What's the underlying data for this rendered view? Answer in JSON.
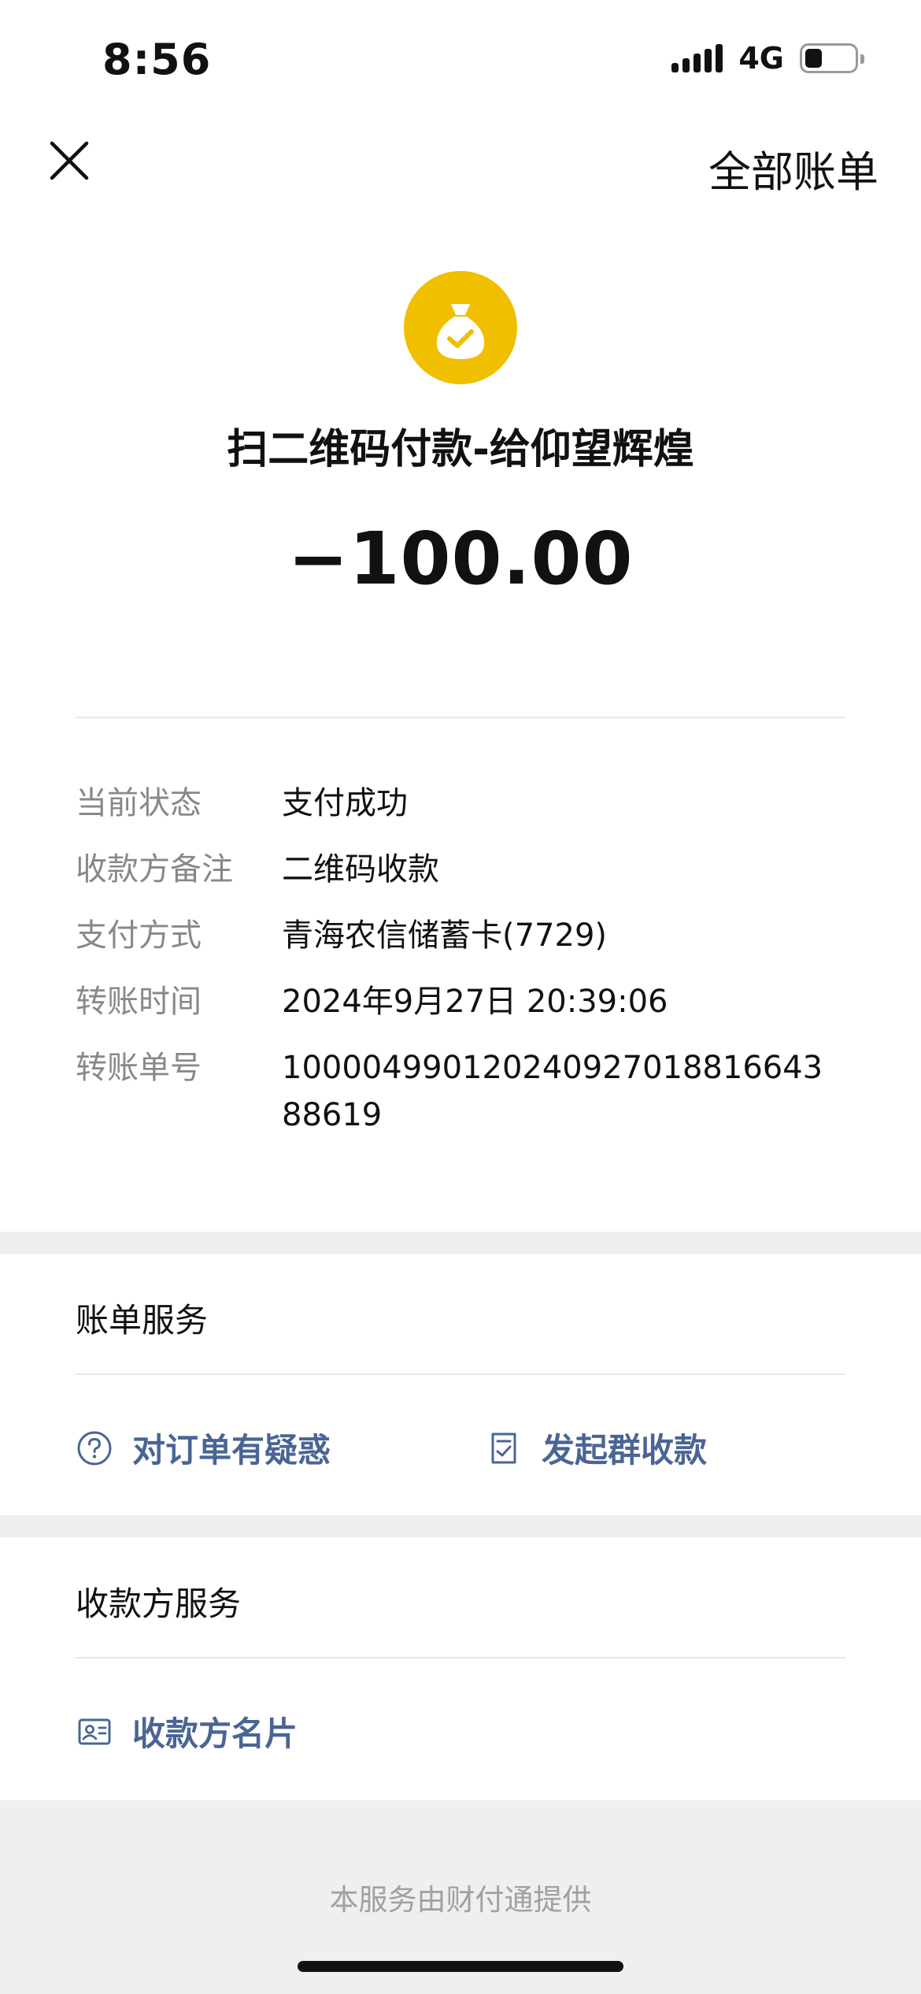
{
  "status_bar": {
    "time": "8:56",
    "network": "4G",
    "battery_level": 0.35
  },
  "nav": {
    "close_icon": "close-icon",
    "right_label": "全部账单"
  },
  "header": {
    "icon": "money-bag-check-icon",
    "icon_color": "#F0BF00",
    "title": "扫二维码付款-给仰望辉煌",
    "amount": "−100.00"
  },
  "details": [
    {
      "label": "当前状态",
      "value": "支付成功"
    },
    {
      "label": "收款方备注",
      "value": "二维码收款"
    },
    {
      "label": "支付方式",
      "value": "青海农信储蓄卡(7729)"
    },
    {
      "label": "转账时间",
      "value": "2024年9月27日 20:39:06"
    },
    {
      "label": "转账单号",
      "value": "100004990120240927018816643 88619"
    }
  ],
  "bill_services": {
    "title": "账单服务",
    "items": [
      {
        "label": "对订单有疑惑",
        "icon": "question-circle-icon"
      },
      {
        "label": "发起群收款",
        "icon": "receipt-check-icon"
      }
    ]
  },
  "payee_services": {
    "title": "收款方服务",
    "items": [
      {
        "label": "收款方名片",
        "icon": "id-card-icon"
      }
    ]
  },
  "footer": {
    "text": "本服务由财付通提供"
  },
  "colors": {
    "link": "#4a6594",
    "accent": "#F0BF00"
  }
}
